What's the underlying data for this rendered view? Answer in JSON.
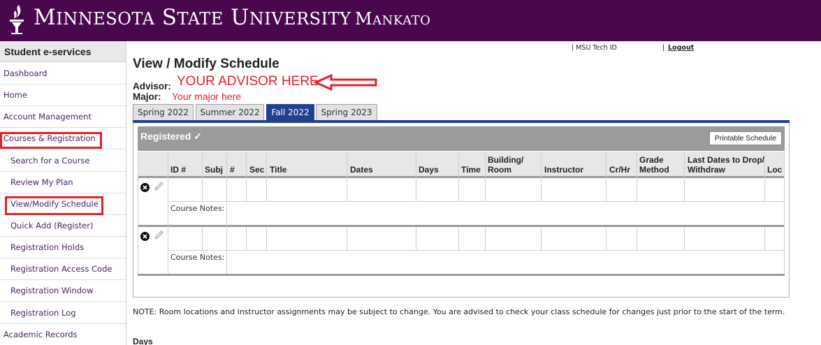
{
  "header": {
    "university_line1": "Minnesota State University",
    "university_line2": "Mankato"
  },
  "sidebar": {
    "title": "Student e-services",
    "items": [
      {
        "label": "Dashboard"
      },
      {
        "label": "Home"
      },
      {
        "label": "Account Management"
      },
      {
        "label": "Courses & Registration"
      },
      {
        "label": "Search for a Course"
      },
      {
        "label": "Review My Plan"
      },
      {
        "label": "View/Modify Schedule"
      },
      {
        "label": "Quick Add (Register)"
      },
      {
        "label": "Registration Holds"
      },
      {
        "label": "Registration Access Code"
      },
      {
        "label": "Registration Window"
      },
      {
        "label": "Registration Log"
      },
      {
        "label": "Academic Records"
      }
    ]
  },
  "top_links": {
    "tech_id": "| MSU Tech ID",
    "separator": "|",
    "logout": "Logout"
  },
  "page": {
    "title": "View / Modify Schedule",
    "advisor_label": "Advisor:",
    "advisor_value": "YOUR ADVISOR HERE",
    "major_label": "Major:",
    "major_value": "Your major here"
  },
  "tabs": [
    {
      "label": "Spring 2022",
      "active": false
    },
    {
      "label": "Summer 2022",
      "active": false
    },
    {
      "label": "Fall 2022",
      "active": true
    },
    {
      "label": "Spring 2023",
      "active": false
    }
  ],
  "registered": {
    "title": "Registered ✓",
    "print_button": "Printable Schedule",
    "columns": [
      "ID #",
      "Subj",
      "#",
      "Sec",
      "Title",
      "Dates",
      "Days",
      "Time",
      "Building/ Room",
      "Instructor",
      "Cr/Hr",
      "Grade Method",
      "Last Dates to Drop/ Withdraw",
      "Loc"
    ],
    "course_notes_label": "Course Notes:"
  },
  "note": "NOTE: Room locations and instructor assignments may be subject to change. You are advised to check your class schedule for changes just prior to the start of the term.",
  "days_heading": "Days",
  "colors": {
    "header_bg": "#49074e",
    "tab_active": "#23408e",
    "annotation_red": "#e5202a"
  }
}
